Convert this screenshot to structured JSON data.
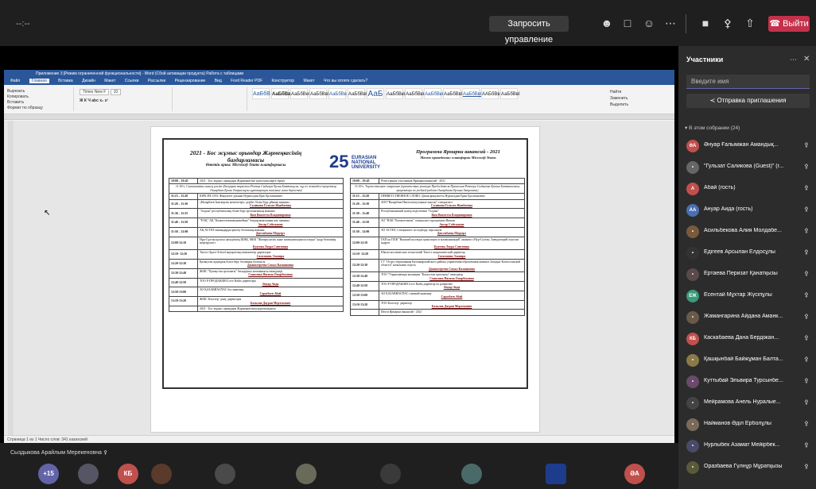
{
  "top_bar": {
    "timer": "--:--",
    "request_control": "Запросить управление",
    "leave": "Выйти",
    "icons": [
      "participants-icon",
      "chat-icon",
      "reactions-icon",
      "more-icon",
      "camera-off-icon",
      "mic-off-icon",
      "share-icon"
    ]
  },
  "word": {
    "title": "Приложение 3 [Режим ограниченной функциональности] - Word (Сбой активации продукта)        Работа с таблицами",
    "tabs": [
      "Файл",
      "Главная",
      "Вставка",
      "Дизайн",
      "Макет",
      "Ссылки",
      "Рассылки",
      "Рецензирование",
      "Вид",
      "Foxit Reader PDF",
      "Конструктор",
      "Макет",
      "Что вы хотите сделать?"
    ],
    "clipboard": [
      "Вырезать",
      "Копировать",
      "Вставить",
      "Формат по образцу"
    ],
    "font_name": "Times New F",
    "font_size": "10",
    "styles": [
      "АаБбВ",
      "АаБбВвІ",
      "АаБбВеІ",
      "АаБбВвІ",
      "АаБбВв",
      "АаБбВвІ",
      "АаБ",
      "АаБбВвІ",
      "АаБбВвІ",
      "АаБбВвІ",
      "АаБбВвІ",
      "АаБбВвІ",
      "ААБбВвІ",
      "АаБбВвІ"
    ],
    "edit": [
      "Найти",
      "Заменить",
      "Выделить"
    ],
    "status": "Страница 1 из 1    Число слов: 341    казахский"
  },
  "doc": {
    "left_title": "2021 - Бос жұмыс орындар Жәрмеңкесінің бағдарламасы",
    "left_sub": "Өтетін орны: Microsoft Teams платформасы",
    "logo_text": [
      "EURASIAN",
      "NATIONAL",
      "UNIVERSITY"
    ],
    "right_title": "Программа Ярмарки вакансий - 2021",
    "right_sub": "Место проведения: платформа Microsoft Teams",
    "left_rows": [
      {
        "t": "10:00 – 10:45",
        "d": "2021 - Бос жұмыс орындары Жәрмеңкесіне қатысушыларға тіркеу"
      },
      {
        "t": "",
        "d": "11:00 ч. Салтанатты ашылу рәсімі (Басқарма төрағасы-Ректор Сыдықов Ерлан Батташұлы, оқу ісі жөніндегі проректор Онгарбаев Ерлан Әмірғалиұлы құттықтауы тиісінше алып берілетін)",
        "c": true
      },
      {
        "t": "11:15 – 11:20",
        "d": "КІРІСПЕ СӨЗ: Факультет деканы Нурмолдин Ерік Ерсазынович"
      },
      {
        "t": "11:20 – 11:30",
        "d": "«Назарбаев Зияткерлік мектептері» дербес білім беру ұйымы маманы",
        "n": "Саликова Гульзат Жамбаевна"
      },
      {
        "t": "11:30 – 11:35",
        "d": "\"Алдын\" республикалық білім беру орталығының маманы",
        "n": "Ким Виолетта Владимировна"
      },
      {
        "t": "11:40 – 11:50",
        "d": "\"ҰАҚ\" АҚ \"Казактелекоммуникейшн\" бағдарламасының жас маманы",
        "n": "Ансар Сейтжанов"
      },
      {
        "t": "11:50 – 12:00",
        "d": "АҚ АСТЕЛ мамандарды іріктеу бөлімінің маманы",
        "n": "Дюсенбаева Меруерт"
      },
      {
        "t": "12:00-12:10",
        "d": "Нұр-Сұлтан қаласы әкімдігінің ШЖБ, МКК \"Жоғары көлік және коммуникация колледжі\" кадр бөлімінің меңгерушісі",
        "n": "Куатова Лаура Советовна"
      },
      {
        "t": "12:10- 12:20",
        "d": "Тиеост Space School ақпараттық-компьютер директоры",
        "n": "Самсонова Эльвира"
      },
      {
        "t": "12:20-12:30",
        "d": "Қазақстан аудандық білім беру бөлімінің басшысы",
        "n": "Джанкгереева Самал Казанновна"
      },
      {
        "t": "12:30-12:40",
        "d": "ЖШС \"Қазақстан орталығы\" басқарушы компаниясы менеджері",
        "n": "Смаилова Нагима Омарбековна"
      },
      {
        "t": "12:40-12:50",
        "d": "ТОО Р-ПРОДАКШН Love Radio директоры",
        "n": "Әнуар Аида"
      },
      {
        "t": "12:50-13:00",
        "d": "АО ҚАЗАВИАСПАС бас инженер",
        "n": "Сарыбаев Абай"
      },
      {
        "t": "13:10-13:20",
        "d": "ЖШС Кластер- даму директоры",
        "n": "Базылов Дауран Мерлекович"
      },
      {
        "t": "",
        "d": "2021 - Бос жұмыс орындары Жәрмеңкесінің қорытындысы"
      }
    ],
    "right_rows": [
      {
        "t": "10:00 – 10:45",
        "d": "Регистрация участников Ярмарки вакансий - 2021"
      },
      {
        "t": "",
        "d": "11:00 ч. Торжественное открытие (приветствие ректора Председателя Правления-Ректора Сыдыкова Ерлана Батташевича, проректора по учебной работе Онгарбаева Ерлана Амировича)",
        "c": true
      },
      {
        "t": "11:15 – 11:20",
        "d": "ПРИВЕТСТВЕННОЕ СЛОВО: Декан факультета Нурмолдин Ерик Ерсазынович"
      },
      {
        "t": "11:20 – 11:30",
        "d": "АОО\"Назарбаев Интеллектуальные школы\" специалист",
        "n": "Саликова Гульзат Жамбаевна"
      },
      {
        "t": "11:30 – 11:40",
        "d": "Республиканский центр подготовки \"Алдын\"",
        "n": "Ким Виолетта Владимировна"
      },
      {
        "t": "11:40 – 11:50",
        "d": "АО \"НАК \"Казактелеком\" специалист программы Ишкам",
        "n": "Ансар Сейтжанов"
      },
      {
        "t": "11:50 – 12:00",
        "d": "АО АСТЕЛ, Специалист по подбору персонала",
        "n": "Дюсенбаева Меруерт"
      },
      {
        "t": "12:00-12:10",
        "d": "ГКП на ПХВ \"Высший колледж транспорта и коммуникаций\" акимата г.Нур-Султан, Заведующий отделом кадров",
        "n": "Куатова Лаура Советовна"
      },
      {
        "t": "12:10- 12:20",
        "d": "Школа космических технологий Тиеост академический директор",
        "n": "Самсонова Эльвира"
      },
      {
        "t": "12:20-12:30",
        "d": "ГУ \"Отдел образования Катонкарагайского района управления образования акимата Западно-Казахстанской области\" начальник отдела",
        "n": "Джанкгереева Самал Казанновна"
      },
      {
        "t": "12:30-12:40",
        "d": "ТОО \"Управляющая компания \"Казахстан орталығы\" менеджер",
        "n": "Смаилова Нагима Омарбековна"
      },
      {
        "t": "12:40-12:50",
        "d": "ТОО Р-ПРОДАКШН Love Radio директор по развитию",
        "n": "Әнуар Аида"
      },
      {
        "t": "12:50-13:00",
        "d": "АО КАЗАВИАСПАС главный инженер",
        "n": "Сарыбаев Абай"
      },
      {
        "t": "13:10-13:20",
        "d": "ТОО Кластер- директор",
        "n": "Базылов Дауран Мерлекович"
      },
      {
        "t": "",
        "d": "Итоги Ярмарки вакансий - 2021"
      }
    ]
  },
  "speaker": "Сыздыкова Арайлым Мерекеновна",
  "strip": {
    "more": "+15",
    "kb": "КБ",
    "ea": "ӘА"
  },
  "panel": {
    "title": "Участники",
    "search_placeholder": "Введите имя",
    "invite": "Отправка приглашения",
    "section": "В этом собрании (24)",
    "participants": [
      {
        "i": "ӘА",
        "n": "Әнуар Ғалымжан Амандық...",
        "c": "#c0504d"
      },
      {
        "i": "•",
        "n": "\"Гульзат Саликова (Guest)\" (г...",
        "c": "#666"
      },
      {
        "i": "А",
        "n": "Абай (гость)",
        "c": "#c0504d"
      },
      {
        "i": "АА",
        "n": "Ануар Аида (гость)",
        "c": "#4a6fb0"
      },
      {
        "i": "•",
        "n": "Асильбекова Алия Молдабе...",
        "c": "#7a5a3a"
      },
      {
        "i": "•",
        "n": "Едігеев Арсылан Елдосұлы",
        "c": "#333"
      },
      {
        "i": "•",
        "n": "Ертаева Перизат Қанатқызы",
        "c": "#5a4a4a"
      },
      {
        "i": "ЕЖ",
        "n": "Есентай Мұхтар Жүсіпұлы",
        "c": "#3a9a7a"
      },
      {
        "i": "•",
        "n": "Жамангарина Айдана Аманк...",
        "c": "#6a5a4a"
      },
      {
        "i": "КБ",
        "n": "Каскабаева Дана Бердіжан...",
        "c": "#c0504d"
      },
      {
        "i": "•",
        "n": "Қашқынбай Байжұман Балта...",
        "c": "#8a7a4a"
      },
      {
        "i": "•",
        "n": "Куттыбай Эльвира Турсынбе...",
        "c": "#6a4a6a"
      },
      {
        "i": "•",
        "n": "Мейрамова Анель Нуралые...",
        "c": "#444"
      },
      {
        "i": "•",
        "n": "Найманов Әділ Ерболұлы",
        "c": "#7a6a5a"
      },
      {
        "i": "•",
        "n": "Нурлыбек Азамат Мейірбек...",
        "c": "#4a4a6a"
      },
      {
        "i": "•",
        "n": "Оразбаева Гүлнұр Мұратқызы",
        "c": "#5a5a3a"
      }
    ]
  }
}
